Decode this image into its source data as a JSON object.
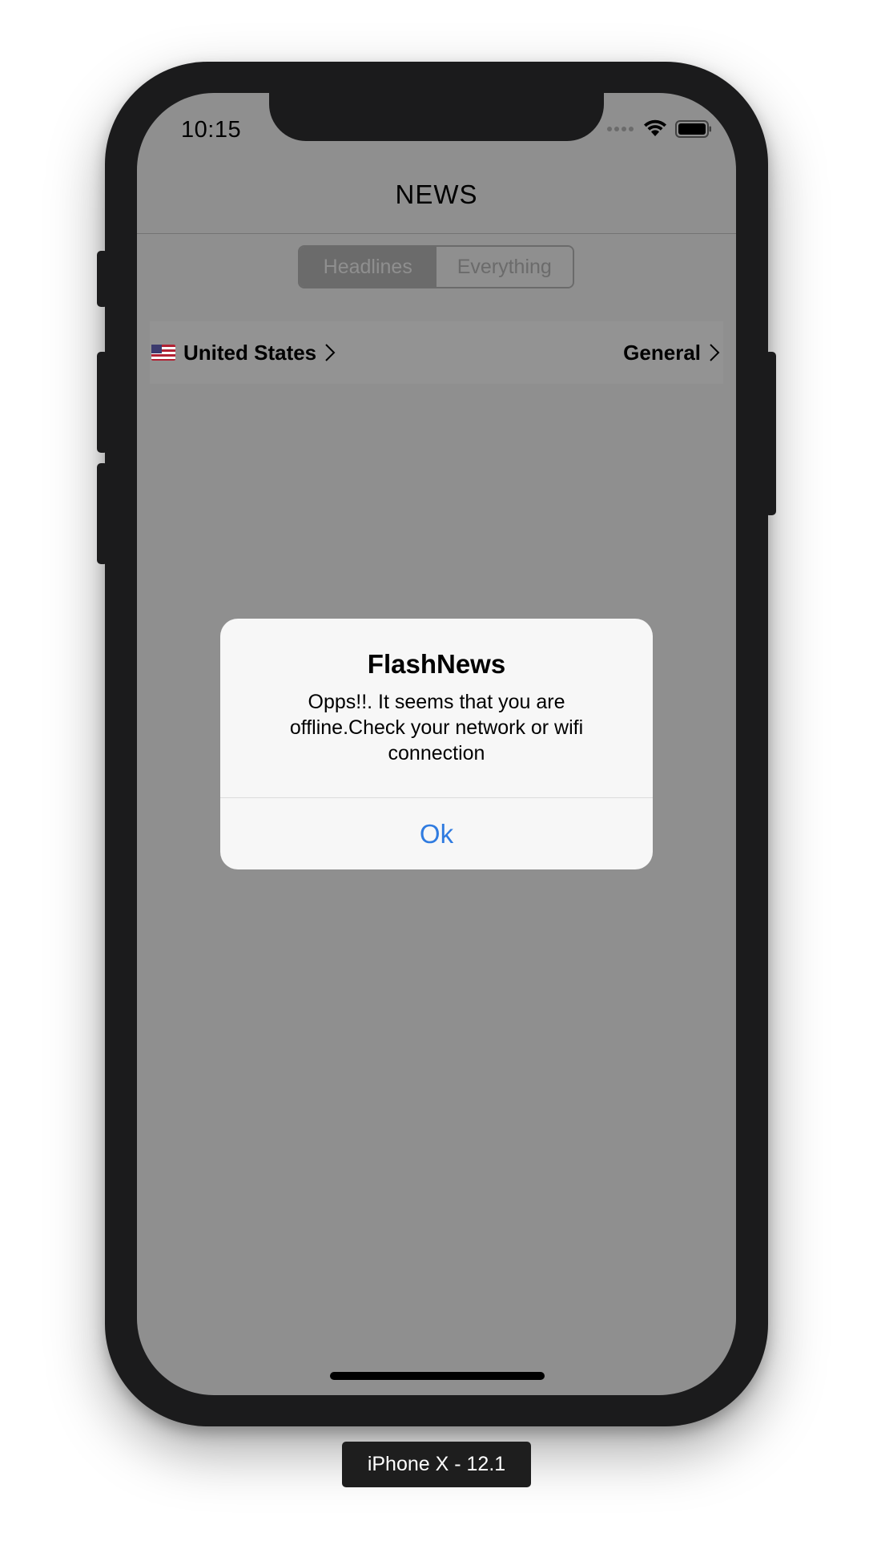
{
  "device": {
    "label": "iPhone X - 12.1"
  },
  "status_bar": {
    "time": "10:15",
    "icons": [
      "signal-dots-icon",
      "wifi-icon",
      "battery-icon"
    ]
  },
  "nav": {
    "title": "NEWS"
  },
  "segmented_control": {
    "segments": [
      {
        "label": "Headlines",
        "selected": true
      },
      {
        "label": "Everything",
        "selected": false
      }
    ]
  },
  "filters": {
    "country": {
      "flag": "us-flag-icon",
      "label": "United States"
    },
    "category": {
      "label": "General"
    }
  },
  "alert": {
    "title": "FlashNews",
    "message": "Opps!!. It seems that you are offline.Check your network or wifi connection",
    "button_label": "Ok"
  },
  "colors": {
    "dimmed_background": "#8f8f8f",
    "alert_background": "#f7f7f7",
    "alert_button": "#2f7be0",
    "device_bezel": "#1b1b1c"
  }
}
